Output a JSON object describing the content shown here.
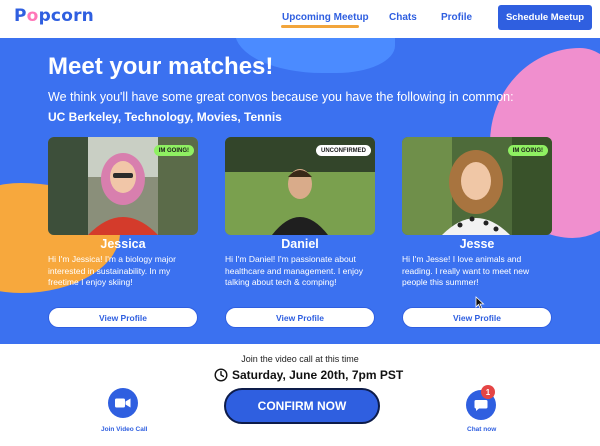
{
  "nav": {
    "logo": [
      "P",
      "o",
      "pcorn"
    ],
    "links": [
      {
        "label": "Upcoming Meetup",
        "active": true
      },
      {
        "label": "Chats",
        "active": false
      },
      {
        "label": "Profile",
        "active": false
      }
    ],
    "schedule_button": "Schedule Meetup"
  },
  "hero": {
    "title": "Meet your matches!",
    "subtitle": "We think you'll have some great convos because you have the following in common:",
    "common": "UC Berkeley, Technology, Movies, Tennis"
  },
  "matches": [
    {
      "name": "Jessica",
      "status": "IM GOING!",
      "bio": "Hi I'm Jessica! I'm a biology major interested in sustainability. In my freetime I enjoy skiing!",
      "button": "View Profile"
    },
    {
      "name": "Daniel",
      "status": "UNCONFIRMED",
      "bio": "Hi I'm Daniel! I'm passionate about healthcare and management. I enjoy talking about tech & comping!",
      "button": "View Profile"
    },
    {
      "name": "Jesse",
      "status": "IM GOING!",
      "bio": "Hi I'm Jesse! I love animals and reading. I really want to meet new people this summer!",
      "button": "View Profile"
    }
  ],
  "footer": {
    "join_text": "Join the video call at this time",
    "datetime": "Saturday, June 20th, 7pm PST",
    "confirm": "CONFIRM NOW",
    "join_video": "Join Video Call",
    "chat_now": "Chat now",
    "chat_notifications": "1"
  },
  "colors": {
    "brand_blue": "#2f5fe0",
    "hero_blue": "#3b71f0",
    "accent_orange": "#f2a53b",
    "accent_pink": "#f08fce",
    "going_green": "#8ff062",
    "notification_red": "#e54545"
  }
}
